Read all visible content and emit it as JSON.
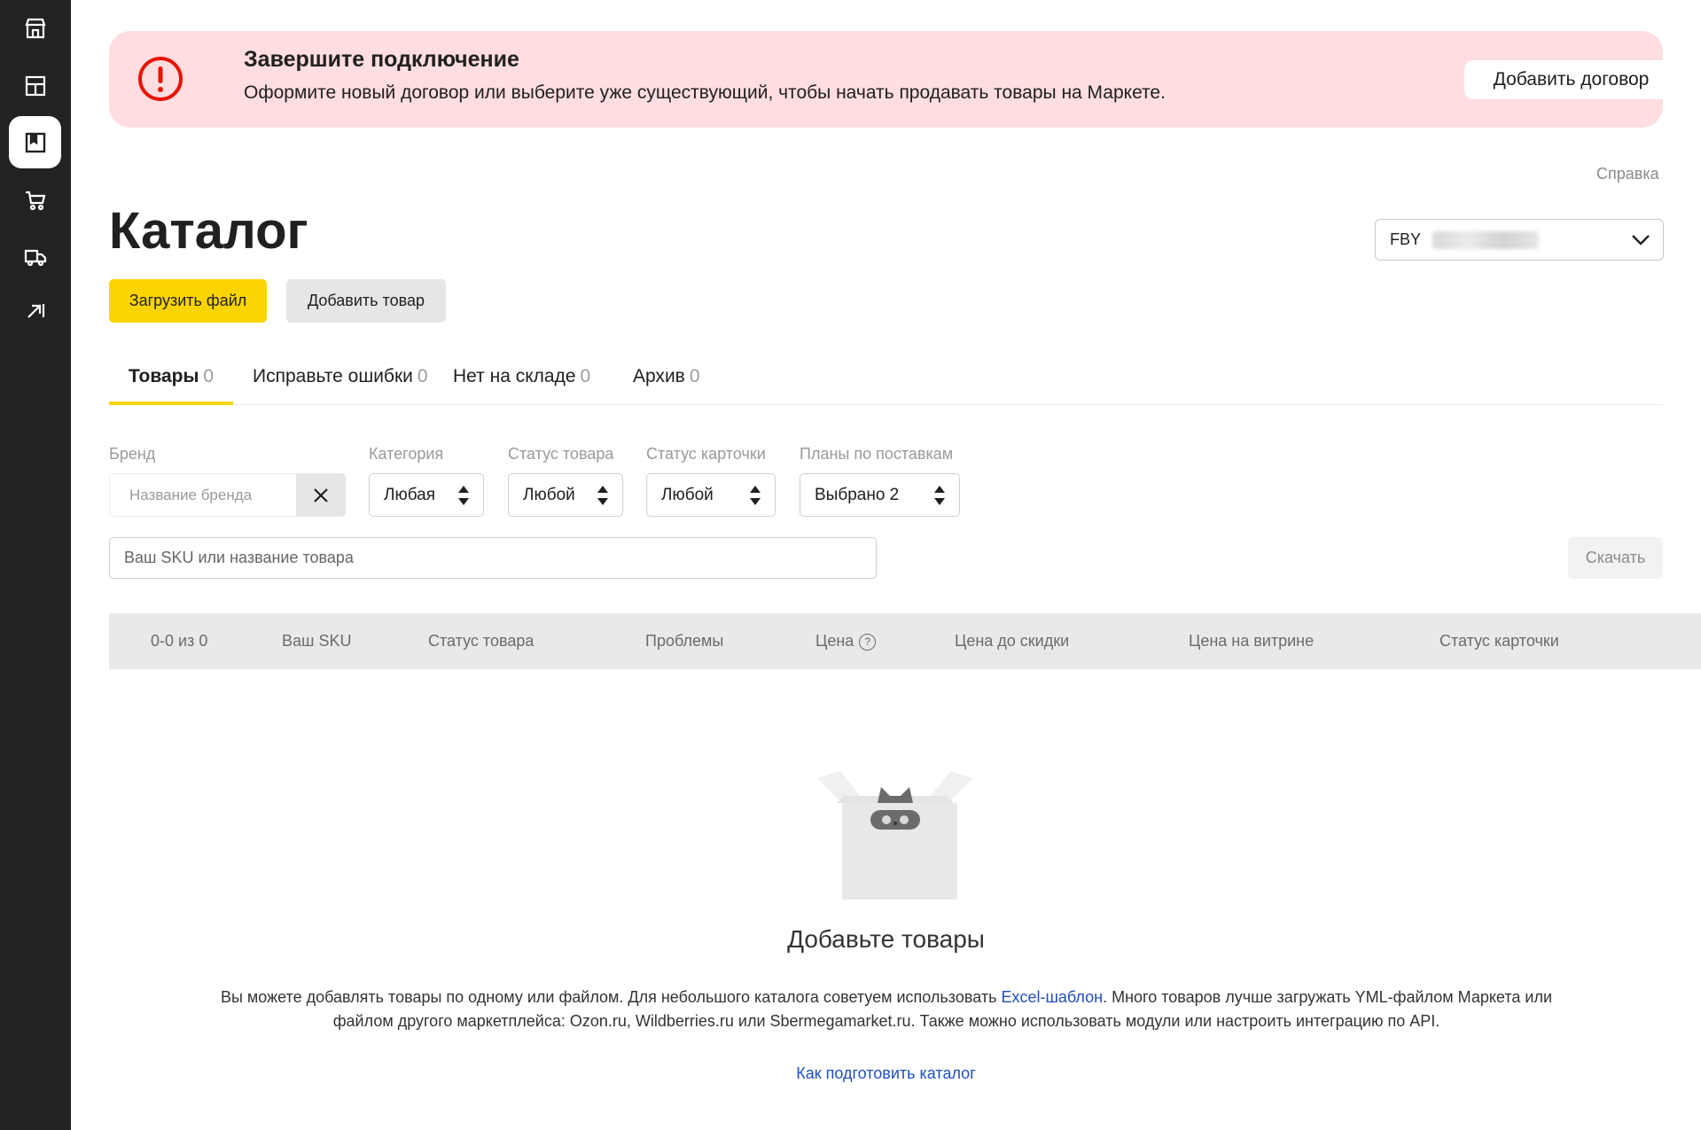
{
  "sidebar": {
    "items": [
      {
        "icon": "storefront-icon",
        "active": false
      },
      {
        "icon": "dashboard-icon",
        "active": false
      },
      {
        "icon": "catalog-icon",
        "active": true
      },
      {
        "icon": "cart-icon",
        "active": false
      },
      {
        "icon": "truck-icon",
        "active": false
      },
      {
        "icon": "expand-arrow-icon",
        "active": false
      }
    ]
  },
  "banner": {
    "title": "Завершите подключение",
    "text": "Оформите новый договор или выберите уже существующий, чтобы начать продавать товары на Маркете.",
    "button_label": "Добавить договор",
    "icon": "alert-icon",
    "color": "#ffdde0",
    "icon_color": "#e61400"
  },
  "header": {
    "help_label": "Справка",
    "title": "Каталог",
    "store_select": {
      "prefix": "FBY"
    }
  },
  "actions": {
    "upload_label": "Загрузить файл",
    "add_label": "Добавить товар",
    "accent": "#fcd400"
  },
  "tabs": [
    {
      "label": "Товары",
      "count": "0",
      "active": true
    },
    {
      "label": "Исправьте ошибки",
      "count": "0",
      "active": false
    },
    {
      "label": "Нет на складе",
      "count": "0",
      "active": false
    },
    {
      "label": "Архив",
      "count": "0",
      "active": false
    }
  ],
  "filters": {
    "brand": {
      "label": "Бренд",
      "placeholder": "Название бренда"
    },
    "category": {
      "label": "Категория",
      "value": "Любая"
    },
    "product_status": {
      "label": "Статус товара",
      "value": "Любой"
    },
    "card_status": {
      "label": "Статус карточки",
      "value": "Любой"
    },
    "supply_plans": {
      "label": "Планы по поставкам",
      "value": "Выбрано 2"
    }
  },
  "search": {
    "placeholder": "Ваш SKU или название товара"
  },
  "download_label": "Скачать",
  "table": {
    "columns": [
      "0-0 из 0",
      "Ваш SKU",
      "Статус товара",
      "Проблемы",
      "Цена",
      "Цена до скидки",
      "Цена на витрине",
      "Статус карточки"
    ],
    "help_glyph": "?"
  },
  "empty": {
    "title": "Добавьте товары",
    "text_before": "Вы можете добавлять товары по одному или файлом. Для небольшого каталога советуем использовать ",
    "link": "Excel-шаблон",
    "text_after": ". Много товаров лучше загружать YML-файлом Маркета или файлом другого маркетплейса: Ozon.ru, Wildberries.ru или Sbermegamarket.ru. Также можно использовать модули или настроить интеграцию по API.",
    "guide_link": "Как подготовить каталог",
    "link_color": "#1f4ec1"
  }
}
